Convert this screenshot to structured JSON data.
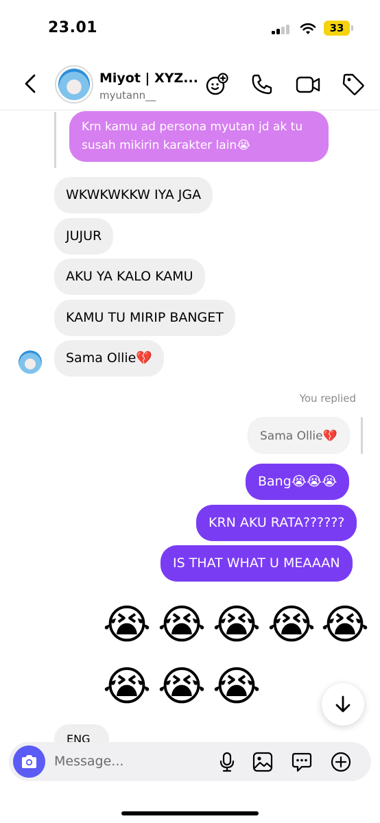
{
  "status_bar": {
    "time": "23.01",
    "battery": "33"
  },
  "header": {
    "contact_name": "Miyot | XYZ...",
    "username": "myutann__",
    "icons": [
      "back-icon",
      "effects-icon",
      "phone-icon",
      "video-icon",
      "tag-icon"
    ]
  },
  "messages": {
    "quoted_top": "Krn kamu ad persona myutan jd ak tu susah mikirin karakter lain😭",
    "in_1": "WKWKWKKW IYA JGA",
    "in_2": "JUJUR",
    "in_3": "AKU YA KALO KAMU",
    "in_4": "KAMU TU MIRIP BANGET",
    "in_5": "Sama Ollie💔",
    "you_replied": "You replied",
    "reply_quote": "Sama Ollie💔",
    "out_1": "Bang😭😭😭",
    "out_2": "KRN AKU RATA??????",
    "out_3": "IS THAT WHAT U MEAAAN",
    "emoji": "😭",
    "emoji_row1_count": 5,
    "emoji_row2_count": 3,
    "partial_incoming": "ENG"
  },
  "composer": {
    "placeholder": "Message...",
    "icons": [
      "camera-icon",
      "microphone-icon",
      "gallery-icon",
      "sticker-icon",
      "plus-icon"
    ]
  },
  "colors": {
    "outgoing_bubble": "#7a3cf3",
    "quoted_bubble": "#d67ff0",
    "incoming_bubble": "#efefef",
    "camera_button": "#5b5cf5",
    "battery": "#f5d40f"
  }
}
